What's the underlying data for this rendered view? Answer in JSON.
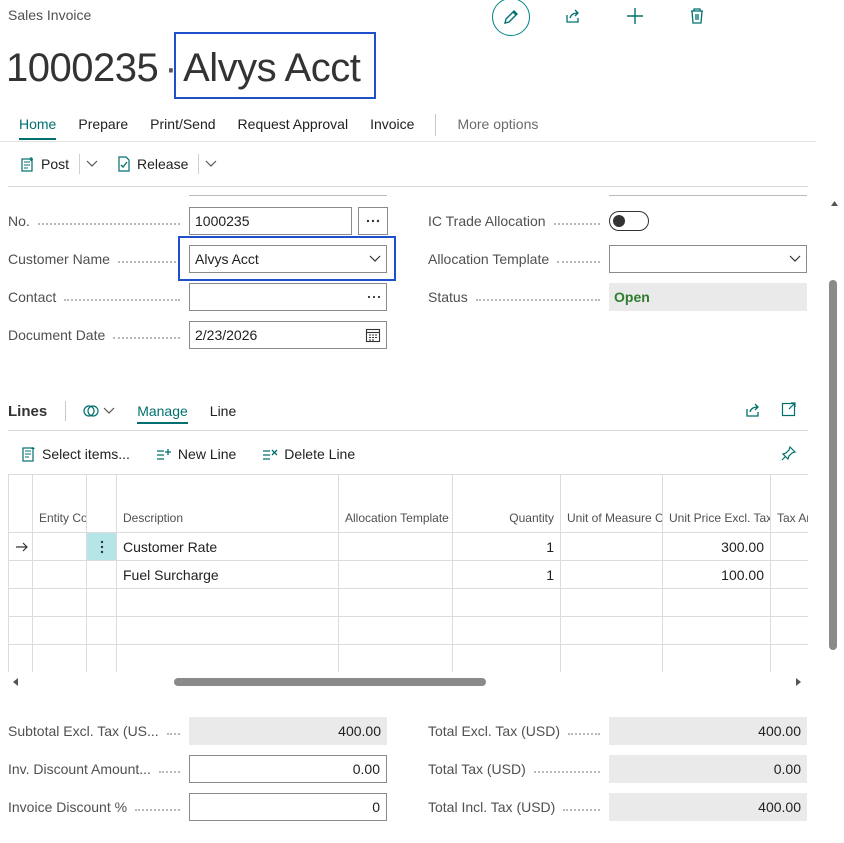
{
  "header": {
    "caption": "Sales Invoice",
    "number": "1000235",
    "separator": "·",
    "customer_name": "Alvys Acct"
  },
  "top_actions": [
    "edit-icon",
    "share-icon",
    "add-icon",
    "delete-icon"
  ],
  "tabs": [
    {
      "label": "Home",
      "active": true
    },
    {
      "label": "Prepare"
    },
    {
      "label": "Print/Send"
    },
    {
      "label": "Request Approval"
    },
    {
      "label": "Invoice"
    },
    {
      "label": "More options",
      "muted": true
    }
  ],
  "actions": {
    "post_label": "Post",
    "release_label": "Release"
  },
  "general": {
    "no": {
      "label": "No.",
      "value": "1000235"
    },
    "customer_name": {
      "label": "Customer Name",
      "value": "Alvys Acct"
    },
    "contact": {
      "label": "Contact",
      "value": ""
    },
    "document_date": {
      "label": "Document Date",
      "value": "2/23/2026"
    },
    "ic_trade_allocation": {
      "label": "IC Trade Allocation",
      "value": false
    },
    "allocation_template": {
      "label": "Allocation Template",
      "value": ""
    },
    "status": {
      "label": "Status",
      "value": "Open"
    }
  },
  "lines": {
    "title": "Lines",
    "tabs": [
      {
        "label": "Manage",
        "active": true
      },
      {
        "label": "Line"
      }
    ],
    "actions": {
      "select_items": "Select items...",
      "new_line": "New Line",
      "delete_line": "Delete Line"
    },
    "columns": {
      "entity_code": "Entity Code",
      "description": "Description",
      "allocation_template": "Allocation Template",
      "quantity": "Quantity",
      "uom": "Unit of Measure Code",
      "unit_price": "Unit Price Excl. Tax",
      "tax_amount": "Tax Ar"
    },
    "rows": [
      {
        "description": "Customer Rate",
        "quantity": "1",
        "unit_price": "300.00",
        "current": true
      },
      {
        "description": "Fuel Surcharge",
        "quantity": "1",
        "unit_price": "100.00"
      },
      {
        "description": "",
        "quantity": "",
        "unit_price": ""
      },
      {
        "description": "",
        "quantity": "",
        "unit_price": ""
      },
      {
        "description": "",
        "quantity": "",
        "unit_price": ""
      }
    ]
  },
  "totals": {
    "subtotal": {
      "label": "Subtotal Excl. Tax (US...",
      "value": "400.00"
    },
    "inv_discount_amount": {
      "label": "Inv. Discount Amount...",
      "value": "0.00"
    },
    "invoice_discount_pct": {
      "label": "Invoice Discount %",
      "value": "0"
    },
    "total_excl_tax": {
      "label": "Total Excl. Tax (USD)",
      "value": "400.00"
    },
    "total_tax": {
      "label": "Total Tax (USD)",
      "value": "0.00"
    },
    "total_incl_tax": {
      "label": "Total Incl. Tax (USD)",
      "value": "400.00"
    }
  },
  "colors": {
    "accent": "#00706f",
    "focus": "#1f4fc9",
    "status_open": "#2d7d2d"
  }
}
